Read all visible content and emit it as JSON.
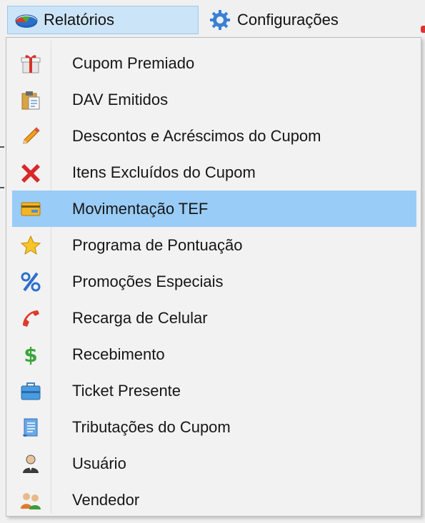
{
  "menubar": {
    "reports_label": "Relatórios",
    "config_label": "Configurações"
  },
  "menu": {
    "items": [
      {
        "label": "Cupom Premiado",
        "icon": "gift-icon"
      },
      {
        "label": "DAV Emitidos",
        "icon": "clipboard-icon"
      },
      {
        "label": "Descontos e Acréscimos do Cupom",
        "icon": "pencil-icon"
      },
      {
        "label": "Itens Excluídos do Cupom",
        "icon": "red-x-icon"
      },
      {
        "label": "Movimentação TEF",
        "icon": "card-icon"
      },
      {
        "label": "Programa de Pontuação",
        "icon": "star-icon"
      },
      {
        "label": "Promoções Especiais",
        "icon": "percent-icon"
      },
      {
        "label": "Recarga de Celular",
        "icon": "phone-icon"
      },
      {
        "label": "Recebimento",
        "icon": "dollar-icon"
      },
      {
        "label": "Ticket Presente",
        "icon": "briefcase-icon"
      },
      {
        "label": "Tributações do Cupom",
        "icon": "scroll-icon"
      },
      {
        "label": "Usuário",
        "icon": "user-icon"
      },
      {
        "label": "Vendedor",
        "icon": "users-icon"
      }
    ],
    "highlighted_index": 4
  },
  "colors": {
    "highlight": "#99ccf6",
    "menubar_active": "#cce4f7"
  }
}
